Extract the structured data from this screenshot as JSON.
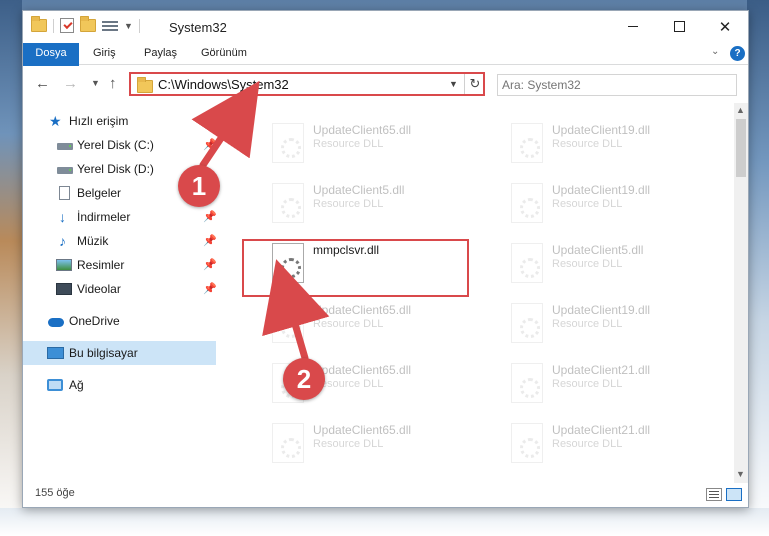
{
  "window": {
    "title": "System32"
  },
  "ribbon": {
    "tabs": [
      "Dosya",
      "Giriş",
      "Paylaş",
      "Görünüm"
    ]
  },
  "address": {
    "path": "C:\\Windows\\System32"
  },
  "search": {
    "placeholder": "Ara: System32"
  },
  "sidebar": {
    "items": [
      {
        "label": "Hızlı erişim",
        "icon": "star-icon"
      },
      {
        "label": "Yerel Disk (C:)",
        "icon": "drive-icon",
        "pinned": true
      },
      {
        "label": "Yerel Disk (D:)",
        "icon": "drive-icon"
      },
      {
        "label": "Belgeler",
        "icon": "documents-icon"
      },
      {
        "label": "İndirmeler",
        "icon": "download-icon",
        "pinned": true
      },
      {
        "label": "Müzik",
        "icon": "music-icon",
        "pinned": true
      },
      {
        "label": "Resimler",
        "icon": "pictures-icon",
        "pinned": true
      },
      {
        "label": "Videolar",
        "icon": "videos-icon",
        "pinned": true
      },
      {
        "label": "OneDrive",
        "icon": "cloud-icon"
      },
      {
        "label": "Bu bilgisayar",
        "icon": "pc-icon",
        "selected": true
      },
      {
        "label": "Ağ",
        "icon": "network-icon"
      }
    ]
  },
  "files": [
    {
      "name": "UpdateClient65.dll",
      "type": "Resource DLL"
    },
    {
      "name": "UpdateClient19.dll",
      "type": "Resource DLL"
    },
    {
      "name": "UpdateClient5.dll",
      "type": "Resource DLL"
    },
    {
      "name": "UpdateClient19.dll",
      "type": "Resource DLL"
    },
    {
      "name": "mmpclsvr.dll",
      "type": "",
      "highlighted": true
    },
    {
      "name": "UpdateClient5.dll",
      "type": "Resource DLL"
    },
    {
      "name": "UpdateClient65.dll",
      "type": "Resource DLL"
    },
    {
      "name": "UpdateClient19.dll",
      "type": "Resource DLL"
    },
    {
      "name": "UpdateClient65.dll",
      "type": "Resource DLL"
    },
    {
      "name": "UpdateClient21.dll",
      "type": "Resource DLL"
    },
    {
      "name": "UpdateClient65.dll",
      "type": "Resource DLL"
    },
    {
      "name": "UpdateClient21.dll",
      "type": "Resource DLL"
    }
  ],
  "status": {
    "count": "155 öğe"
  },
  "annotations": {
    "step1": "1",
    "step2": "2",
    "color": "#d9494b"
  }
}
